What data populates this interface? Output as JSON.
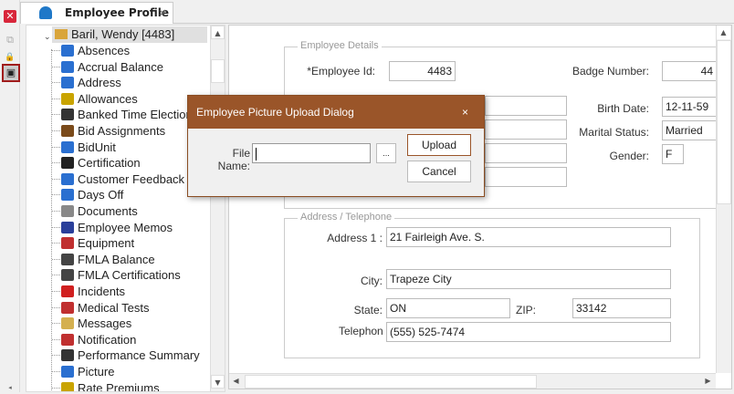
{
  "tab": {
    "title": "Employee Profile",
    "close": "×"
  },
  "toolbar": {
    "close": "✕",
    "copy": "⧉",
    "lock": "🔒",
    "picture": "▣"
  },
  "tree": {
    "root": "Baril, Wendy [4483]",
    "items": [
      "Absences",
      "Accrual Balance",
      "Address",
      "Allowances",
      "Banked Time Election",
      "Bid Assignments",
      "BidUnit",
      "Certification",
      "Customer Feedback",
      "Days Off",
      "Documents",
      "Employee Memos",
      "Equipment",
      "FMLA Balance",
      "FMLA Certifications",
      "Incidents",
      "Medical Tests",
      "Messages",
      "Notification",
      "Performance Summary",
      "Picture",
      "Rate Premiums"
    ],
    "icon_colors": [
      "#2a6fd0",
      "#2a6fd0",
      "#2a6fd0",
      "#c9a400",
      "#333",
      "#7a4a1a",
      "#2a6fd0",
      "#222",
      "#2a6fd0",
      "#2a6fd0",
      "#888",
      "#2a3f9a",
      "#c03030",
      "#444",
      "#444",
      "#d02020",
      "#c03030",
      "#d4b050",
      "#c03030",
      "#333",
      "#2a6fd0",
      "#c9a400"
    ]
  },
  "employee_details": {
    "legend": "Employee Details",
    "employee_id_label": "*Employee Id:",
    "employee_id": "4483",
    "badge_label": "Badge Number:",
    "badge": "44",
    "birth_label": "Birth Date:",
    "birth": "12-11-59",
    "marital_label": "Marital Status:",
    "marital": "Married",
    "gender_label": "Gender:",
    "gender": "F"
  },
  "address": {
    "legend": "Address / Telephone",
    "address1_label": "Address 1 :",
    "address1": "21 Fairleigh Ave. S.",
    "city_label": "City:",
    "city": "Trapeze City",
    "state_label": "State:",
    "state": "ON",
    "zip_label": "ZIP:",
    "zip": "33142",
    "phone_label": "Telephon",
    "phone": "(555) 525-7474"
  },
  "dialog": {
    "title": "Employee Picture Upload Dialog",
    "close": "×",
    "file_label": "File Name:",
    "file_value": "",
    "browse": "...",
    "upload": "Upload",
    "cancel": "Cancel"
  }
}
